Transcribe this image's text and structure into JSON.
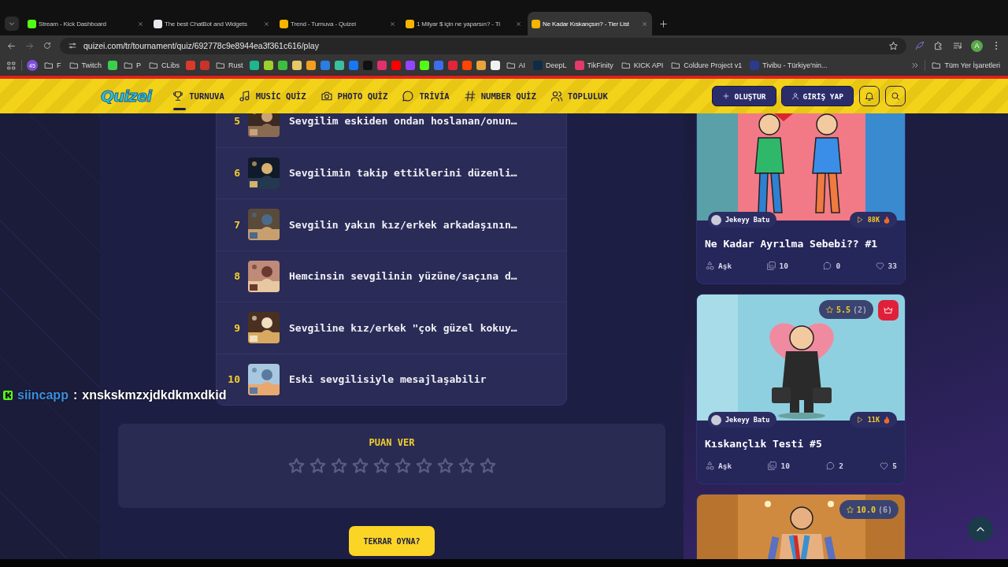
{
  "browser": {
    "tabs": [
      {
        "title": "Stream - Kick Dashboard",
        "color": "#53fc18",
        "selected": false
      },
      {
        "title": "The best ChatBot and Widgets",
        "color": "#e8eaed",
        "selected": false
      },
      {
        "title": "Trend - Turnuva - Quizei",
        "color": "#f4b400",
        "selected": false
      },
      {
        "title": "1 Milyar $ için ne yaparsın? - Ti",
        "color": "#f4b400",
        "selected": false
      },
      {
        "title": "Ne Kadar Kıskançsın? - Tier List",
        "color": "#f4b400",
        "selected": true
      }
    ],
    "address": "quizei.com/tr/tournament/quiz/692778c9e8944ea3f361c616/play",
    "profile_initial": "A",
    "bookmarks": [
      {
        "kind": "counter",
        "label": "45",
        "color": "#7b4fd6"
      },
      {
        "kind": "folder",
        "label": "F"
      },
      {
        "kind": "folder",
        "label": "Twitch"
      },
      {
        "kind": "site",
        "color": "#3ccf4e"
      },
      {
        "kind": "folder",
        "label": "P"
      },
      {
        "kind": "folder",
        "label": "CLibs"
      },
      {
        "kind": "site",
        "color": "#d93a2b"
      },
      {
        "kind": "site",
        "color": "#c8332a"
      },
      {
        "kind": "folder",
        "label": "Rust"
      },
      {
        "kind": "site",
        "color": "#1fb58f"
      },
      {
        "kind": "site",
        "color": "#9bd12a"
      },
      {
        "kind": "site",
        "color": "#3fbf3f"
      },
      {
        "kind": "site",
        "color": "#e6c86a"
      },
      {
        "kind": "site",
        "color": "#f0a020"
      },
      {
        "kind": "site",
        "color": "#2a7de1"
      },
      {
        "kind": "site",
        "color": "#3bbfa0"
      },
      {
        "kind": "site",
        "color": "#1877f2"
      },
      {
        "kind": "site",
        "color": "#111111"
      },
      {
        "kind": "site",
        "color": "#e1306c"
      },
      {
        "kind": "site",
        "color": "#ff0000"
      },
      {
        "kind": "site",
        "color": "#9146ff"
      },
      {
        "kind": "site",
        "color": "#53fc18"
      },
      {
        "kind": "site",
        "color": "#3b6ee8"
      },
      {
        "kind": "site",
        "color": "#e0263a"
      },
      {
        "kind": "site",
        "color": "#ff4500"
      },
      {
        "kind": "site",
        "color": "#e8a33c"
      },
      {
        "kind": "site",
        "color": "#f0f0f0"
      },
      {
        "kind": "folder",
        "label": "AI"
      },
      {
        "kind": "site",
        "label": "DeepL",
        "color": "#0f2b46"
      },
      {
        "kind": "site",
        "label": "TikFinity",
        "color": "#e23a6a"
      },
      {
        "kind": "folder",
        "label": "KICK API"
      },
      {
        "kind": "folder",
        "label": "Coldure Project v1"
      },
      {
        "kind": "site",
        "label": "Tivibu - Türkiye'nin...",
        "color": "#2b3a8c"
      }
    ],
    "all_bookmarks": "Tüm Yer İşaretleri"
  },
  "nav": {
    "logo": "Quizei",
    "items": [
      {
        "label": "TURNUVA",
        "selected": true
      },
      {
        "label": "MUSİC QUİZ",
        "selected": false
      },
      {
        "label": "PHOTO QUİZ",
        "selected": false
      },
      {
        "label": "TRİVİA",
        "selected": false
      },
      {
        "label": "NUMBER QUİZ",
        "selected": false
      },
      {
        "label": "TOPLULUK",
        "selected": false
      }
    ],
    "create_button": "OLUŞTUR",
    "login_button": "GİRİŞ YAP"
  },
  "list": {
    "rows": [
      {
        "rank": "5",
        "text": "Sevgilim eskiden ondan hoslanan/onun…"
      },
      {
        "rank": "6",
        "text": "Sevgilimin takip ettiklerini düzenli…"
      },
      {
        "rank": "7",
        "text": "Sevgilin yakın kız/erkek arkadaşının…"
      },
      {
        "rank": "8",
        "text": "Hemcinsin sevgilinin yüzüne/saçına d…"
      },
      {
        "rank": "9",
        "text": "Sevgiline kız/erkek \"çok güzel kokuy…"
      },
      {
        "rank": "10",
        "text": "Eski sevgilisiyle mesajlaşabilir"
      }
    ]
  },
  "rating": {
    "title": "PUAN VER",
    "stars": 0
  },
  "replay_button": "TEKRAR OYNA?",
  "cards": [
    {
      "author": "Jekeyy Batu",
      "plays": "88K",
      "title": "Ne Kadar Ayrılma Sebebi?? #1",
      "category": "Aşk",
      "images": "10",
      "comments": "0",
      "likes": "33"
    },
    {
      "rating": "5.5",
      "votes": "(2)",
      "crown": true,
      "author": "Jekeyy Batu",
      "plays": "11K",
      "title": "Kıskançlık Testi #5",
      "category": "Aşk",
      "images": "10",
      "comments": "2",
      "likes": "5"
    },
    {
      "rating": "10.0",
      "votes": "(6)",
      "crown": false
    }
  ],
  "chat": {
    "user": "siincapp",
    "separator": ":",
    "message": "xnskskmzxjdkdkmxdkid"
  }
}
